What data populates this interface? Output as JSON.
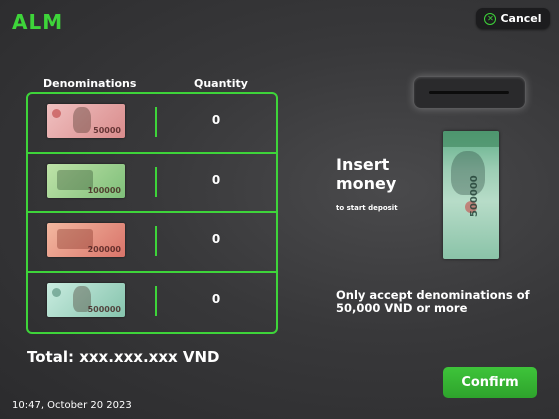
{
  "header": {
    "logo": "ALM",
    "cancel_label": "Cancel"
  },
  "table": {
    "col_denominations": "Denominations",
    "col_quantity": "Quantity",
    "rows": [
      {
        "note_value": "50000",
        "note_color": "#e8a9a9",
        "quantity": "0"
      },
      {
        "note_value": "100000",
        "note_color": "#9ed19c",
        "quantity": "0"
      },
      {
        "note_value": "200000",
        "note_color": "#e99a86",
        "quantity": "0"
      },
      {
        "note_value": "500000",
        "note_color": "#a9d8c4",
        "quantity": "0"
      }
    ]
  },
  "insert": {
    "title": "Insert money",
    "subtitle": "to start deposit",
    "banknote_value": "500000"
  },
  "notice": "Only accept denominations of 50,000 VND or more",
  "total": "Total: xxx.xxx.xxx VND",
  "confirm_label": "Confirm",
  "datetime": "10:47, October 20 2023",
  "colors": {
    "accent": "#3ed43a",
    "background": "#38383a"
  }
}
